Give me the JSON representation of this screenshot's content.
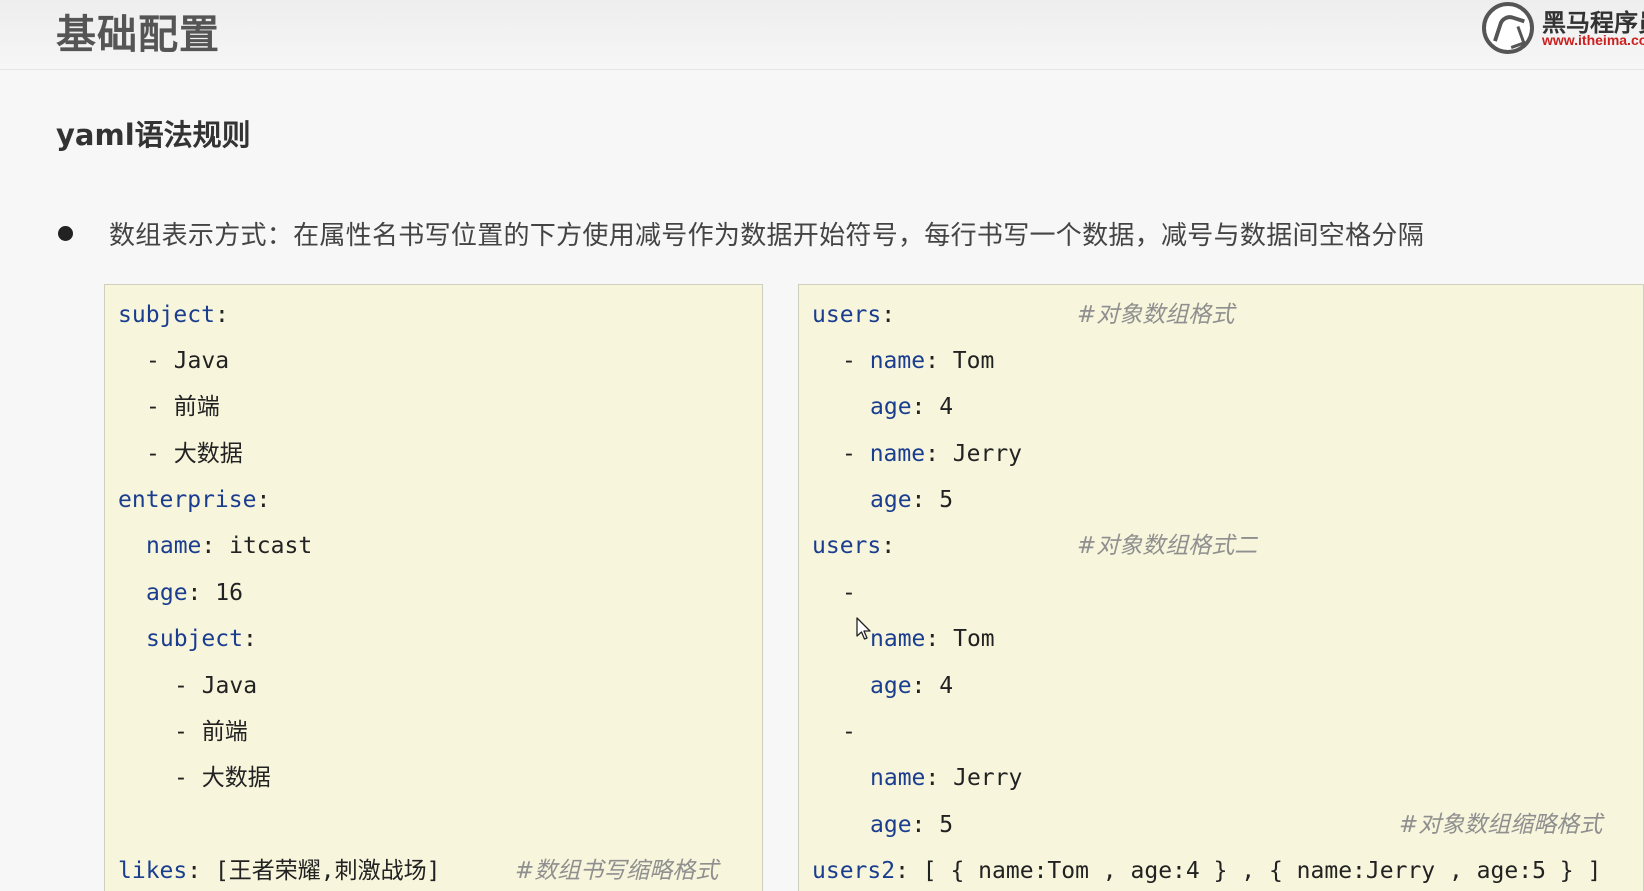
{
  "header": {
    "title": "基础配置",
    "logo_name": "黑马程序员",
    "logo_url": "www.itheima.com",
    "logo_icon": "itheima-horse-logo"
  },
  "section_title": "yaml语法规则",
  "bullet": "数组表示方式：在属性名书写位置的下方使用减号作为数据开始符号，每行书写一个数据，减号与数据间空格分隔",
  "left_code": {
    "subject_key": "subject",
    "subject_items": [
      "Java",
      "前端",
      "大数据"
    ],
    "enterprise_key": "enterprise",
    "name_key": "name",
    "name_value": "itcast",
    "age_key": "age",
    "age_value": "16",
    "inner_subject_key": "subject",
    "inner_subject_items": [
      "Java",
      "前端",
      "大数据"
    ],
    "likes_key": "likes",
    "likes_value": "[王者荣耀,刺激战场]",
    "likes_comment": "#数组书写缩略格式"
  },
  "right_code": {
    "users_key": "users",
    "users_comment": "#对象数组格式",
    "u1_name_key": "name",
    "u1_name_value": "Tom",
    "u1_age_key": "age",
    "u1_age_value": "4",
    "u2_name_key": "name",
    "u2_name_value": "Jerry",
    "u2_age_key": "age",
    "u2_age_value": "5",
    "users_b_key": "users",
    "users_b_comment": "#对象数组格式二",
    "b1_name_key": "name",
    "b1_name_value": "Tom",
    "b1_age_key": "age",
    "b1_age_value": "4",
    "b2_name_key": "name",
    "b2_name_value": "Jerry",
    "b2_age_key": "age",
    "b2_age_value": "5",
    "short_comment": "#对象数组缩略格式",
    "users2_key": "users2",
    "users2_value": "[ { name:Tom , age:4 } , { name:Jerry , age:5 } ]"
  }
}
